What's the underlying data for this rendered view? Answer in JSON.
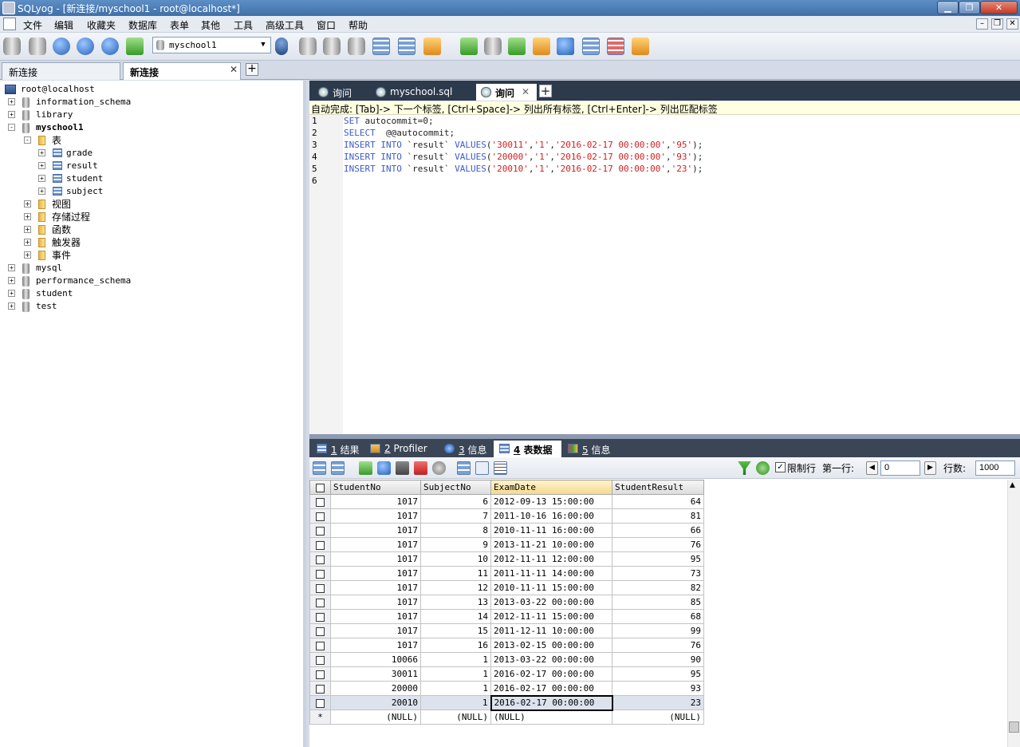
{
  "window": {
    "title": "SQLyog - [新连接/myschool1 - root@localhost*]",
    "minimize": "▁",
    "maximize": "❐",
    "close": "✕"
  },
  "menu": {
    "items": [
      "文件",
      "编辑",
      "收藏夹",
      "数据库",
      "表单",
      "其他",
      "工具",
      "高级工具",
      "窗口",
      "帮助"
    ]
  },
  "mdi": {
    "minimize": "–",
    "restore": "❐",
    "close": "✕"
  },
  "toolbar": {
    "database_select": "myschool1",
    "caret": "▼"
  },
  "conn_tabs": [
    {
      "label": "新连接"
    },
    {
      "label": "新连接"
    }
  ],
  "conn_tab_close": "✕",
  "conn_tab_add": "+",
  "tree": {
    "root": "root@localhost",
    "databases": [
      "information_schema",
      "library",
      "myschool1",
      "mysql",
      "performance_schema",
      "student",
      "test"
    ],
    "myschool1_children": {
      "tables_folder": "表",
      "tables": [
        "grade",
        "result",
        "student",
        "subject"
      ],
      "folders": [
        "视图",
        "存储过程",
        "函数",
        "触发器",
        "事件"
      ]
    }
  },
  "query_tabs": [
    {
      "label": "询问"
    },
    {
      "label": "myschool.sql"
    },
    {
      "label": "询问"
    }
  ],
  "query_tab_close": "✕",
  "query_tab_add": "+",
  "autocomplete": "自动完成: [Tab]-> 下一个标签, [Ctrl+Space]-> 列出所有标签, [Ctrl+Enter]-> 列出匹配标签",
  "editor": {
    "line_numbers": [
      "1",
      "2",
      "3",
      "4",
      "5",
      "6"
    ],
    "lines": [
      [
        {
          "t": "SET",
          "c": "kw"
        },
        {
          "t": " autocommit=0;",
          "c": "op"
        }
      ],
      [
        {
          "t": "SELECT",
          "c": "kw"
        },
        {
          "t": "  @@autocommit;",
          "c": "op"
        }
      ],
      [
        {
          "t": "INSERT INTO",
          "c": "kw"
        },
        {
          "t": " `result` ",
          "c": "op"
        },
        {
          "t": "VALUES",
          "c": "kw"
        },
        {
          "t": "(",
          "c": "op"
        },
        {
          "t": "'30011'",
          "c": "str"
        },
        {
          "t": ",",
          "c": "op"
        },
        {
          "t": "'1'",
          "c": "str"
        },
        {
          "t": ",",
          "c": "op"
        },
        {
          "t": "'2016-02-17 00:00:00'",
          "c": "str"
        },
        {
          "t": ",",
          "c": "op"
        },
        {
          "t": "'95'",
          "c": "str"
        },
        {
          "t": ");",
          "c": "op"
        }
      ],
      [
        {
          "t": "INSERT INTO",
          "c": "kw"
        },
        {
          "t": " `result` ",
          "c": "op"
        },
        {
          "t": "VALUES",
          "c": "kw"
        },
        {
          "t": "(",
          "c": "op"
        },
        {
          "t": "'20000'",
          "c": "str"
        },
        {
          "t": ",",
          "c": "op"
        },
        {
          "t": "'1'",
          "c": "str"
        },
        {
          "t": ",",
          "c": "op"
        },
        {
          "t": "'2016-02-17 00:00:00'",
          "c": "str"
        },
        {
          "t": ",",
          "c": "op"
        },
        {
          "t": "'93'",
          "c": "str"
        },
        {
          "t": ");",
          "c": "op"
        }
      ],
      [
        {
          "t": "INSERT INTO",
          "c": "kw"
        },
        {
          "t": " `result` ",
          "c": "op"
        },
        {
          "t": "VALUES",
          "c": "kw"
        },
        {
          "t": "(",
          "c": "op"
        },
        {
          "t": "'20010'",
          "c": "str"
        },
        {
          "t": ",",
          "c": "op"
        },
        {
          "t": "'1'",
          "c": "str"
        },
        {
          "t": ",",
          "c": "op"
        },
        {
          "t": "'2016-02-17 00:00:00'",
          "c": "str"
        },
        {
          "t": ",",
          "c": "op"
        },
        {
          "t": "'23'",
          "c": "str"
        },
        {
          "t": ");",
          "c": "op"
        }
      ],
      []
    ]
  },
  "result_tabs": [
    {
      "num": "1",
      "label": "结果"
    },
    {
      "num": "2",
      "label": "Profiler"
    },
    {
      "num": "3",
      "label": "信息"
    },
    {
      "num": "4",
      "label": "表数据"
    },
    {
      "num": "5",
      "label": "信息"
    }
  ],
  "result_toolbar": {
    "limit_label": "限制行",
    "first_row_label": "第一行:",
    "first_row_value": "0",
    "rows_label": "行数:",
    "rows_value": "1000",
    "limit_checked": "✓",
    "prev": "◀",
    "next": "▶"
  },
  "grid": {
    "columns": [
      "StudentNo",
      "SubjectNo",
      "ExamDate",
      "StudentResult"
    ],
    "rows": [
      [
        "1017",
        "6",
        "2012-09-13 15:00:00",
        "64"
      ],
      [
        "1017",
        "7",
        "2011-10-16 16:00:00",
        "81"
      ],
      [
        "1017",
        "8",
        "2010-11-11 16:00:00",
        "66"
      ],
      [
        "1017",
        "9",
        "2013-11-21 10:00:00",
        "76"
      ],
      [
        "1017",
        "10",
        "2012-11-11 12:00:00",
        "95"
      ],
      [
        "1017",
        "11",
        "2011-11-11 14:00:00",
        "73"
      ],
      [
        "1017",
        "12",
        "2010-11-11 15:00:00",
        "82"
      ],
      [
        "1017",
        "13",
        "2013-03-22 00:00:00",
        "85"
      ],
      [
        "1017",
        "14",
        "2012-11-11 15:00:00",
        "68"
      ],
      [
        "1017",
        "15",
        "2011-12-11 10:00:00",
        "99"
      ],
      [
        "1017",
        "16",
        "2013-02-15 00:00:00",
        "76"
      ],
      [
        "10066",
        "1",
        "2013-03-22 00:00:00",
        "90"
      ],
      [
        "30011",
        "1",
        "2016-02-17 00:00:00",
        "95"
      ],
      [
        "20000",
        "1",
        "2016-02-17 00:00:00",
        "93"
      ],
      [
        "20010",
        "1",
        "2016-02-17 00:00:00",
        "23"
      ]
    ],
    "new_row_marker": "*",
    "null_text": "(NULL)"
  }
}
